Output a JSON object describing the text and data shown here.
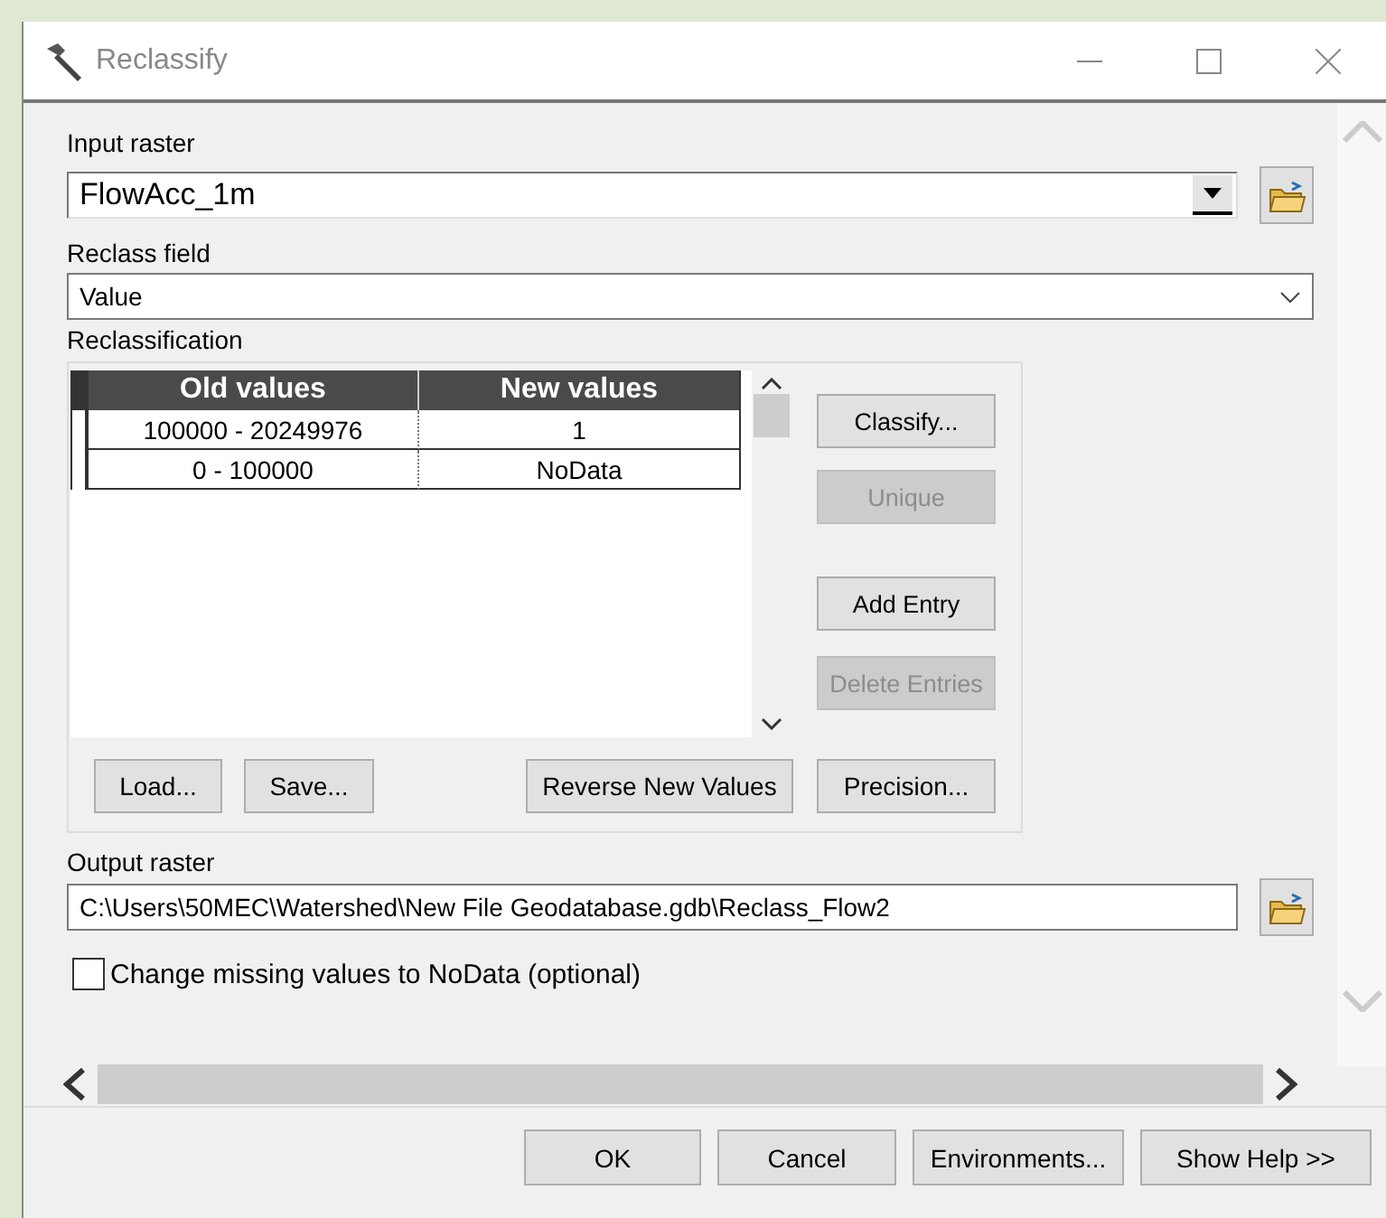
{
  "window": {
    "title": "Reclassify"
  },
  "input_raster": {
    "label": "Input raster",
    "value": "FlowAcc_1m"
  },
  "reclass_field": {
    "label": "Reclass field",
    "value": "Value"
  },
  "reclassification": {
    "label": "Reclassification",
    "table": {
      "columns": [
        "Old values",
        "New values"
      ],
      "rows": [
        [
          "100000 - 20249976",
          "1"
        ],
        [
          "0 - 100000",
          "NoData"
        ]
      ]
    },
    "side_buttons": [
      {
        "label": "Classify...",
        "disabled": false
      },
      {
        "label": "Unique",
        "disabled": true
      },
      {
        "label": "Add Entry",
        "disabled": false
      },
      {
        "label": "Delete Entries",
        "disabled": true
      }
    ],
    "bottom_buttons": [
      {
        "label": "Load...",
        "disabled": false
      },
      {
        "label": "Save...",
        "disabled": false
      },
      {
        "label": "Reverse New Values",
        "disabled": false
      },
      {
        "label": "Precision...",
        "disabled": false
      }
    ]
  },
  "output_raster": {
    "label": "Output raster",
    "value": "C:\\Users\\50MEC\\Watershed\\New File Geodatabase.gdb\\Reclass_Flow2"
  },
  "missing_values": {
    "label": "Change missing values to NoData (optional)",
    "checked": false
  },
  "footer_buttons": [
    "OK",
    "Cancel",
    "Environments...",
    "Show Help >>"
  ]
}
